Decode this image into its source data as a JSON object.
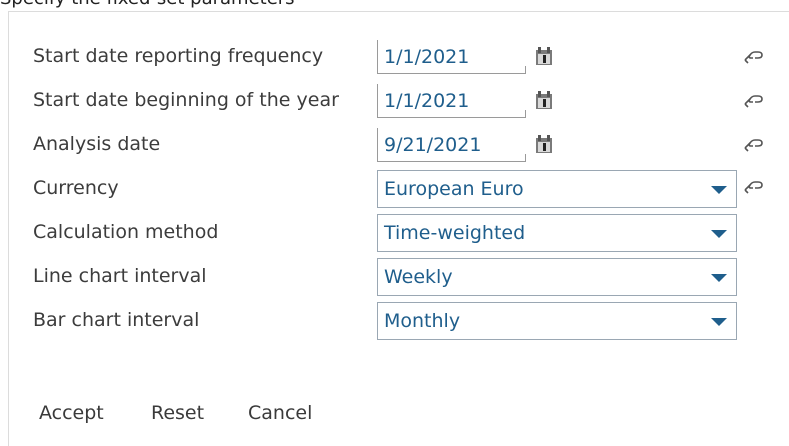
{
  "dialog": {
    "heading": "Specify the fixed-set parameters"
  },
  "fields": [
    {
      "label": "Start date reporting frequency",
      "value": "1/1/2021"
    },
    {
      "label": "Start date beginning of the year",
      "value": "1/1/2021"
    },
    {
      "label": "Analysis date",
      "value": "9/21/2021"
    },
    {
      "label": "Currency",
      "value": "European Euro"
    },
    {
      "label": "Calculation method",
      "value": "Time-weighted"
    },
    {
      "label": "Line chart interval",
      "value": "Weekly"
    },
    {
      "label": "Bar chart interval",
      "value": "Monthly"
    }
  ],
  "buttons": {
    "accept": "Accept",
    "reset": "Reset",
    "cancel": "Cancel"
  },
  "icons": {
    "date_picker": "calendar-icon",
    "parameter_link": "link-icon",
    "dropdown": "chevron-down-icon"
  },
  "colors": {
    "value_text": "#1f5e8c",
    "select_border": "#9aa7b3",
    "label_text": "#3c3c3c"
  }
}
